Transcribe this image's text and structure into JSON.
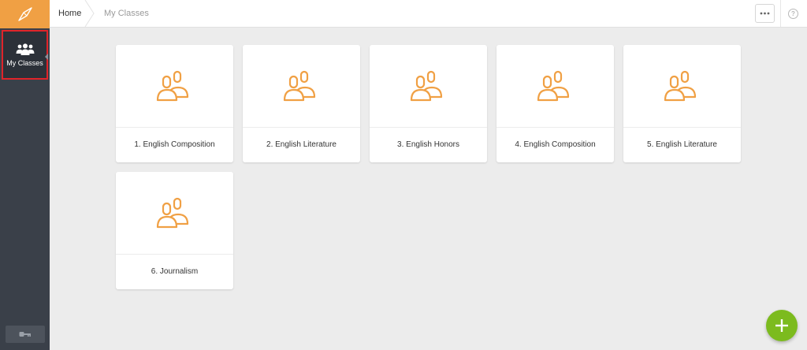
{
  "sidebar": {
    "logo_icon": "compass-icon",
    "items": [
      {
        "label": "My Classes",
        "icon": "users-icon",
        "active": true
      }
    ],
    "logout_icon": "key-icon"
  },
  "topbar": {
    "breadcrumb": {
      "home": "Home",
      "current": "My Classes"
    },
    "more_icon": "more-dots-icon",
    "help_icon": "help-icon",
    "help_glyph": "?"
  },
  "classes": [
    {
      "label": "1. English Composition",
      "icon": "users-icon"
    },
    {
      "label": "2. English Literature",
      "icon": "users-icon"
    },
    {
      "label": "3. English Honors",
      "icon": "users-icon"
    },
    {
      "label": "4. English Composition",
      "icon": "users-icon"
    },
    {
      "label": "5. English Literature",
      "icon": "users-icon"
    },
    {
      "label": "6. Journalism",
      "icon": "users-icon"
    }
  ],
  "fab": {
    "icon": "plus-icon"
  },
  "colors": {
    "accent": "#f0a044",
    "sidebar": "#3a4049",
    "active_border": "#e0242a",
    "fab": "#7cbb1e"
  }
}
